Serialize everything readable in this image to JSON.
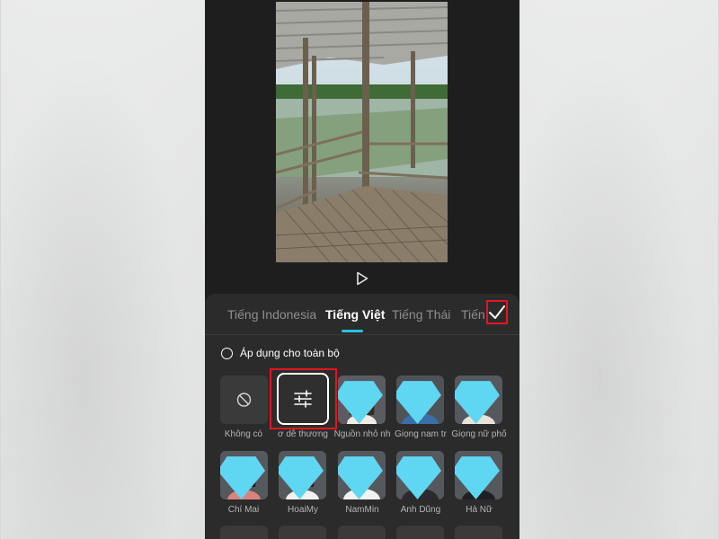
{
  "tabs": [
    {
      "label": "Tiếng Indonesia",
      "active": false
    },
    {
      "label": "Tiếng Việt",
      "active": true
    },
    {
      "label": "Tiếng Thái",
      "active": false
    },
    {
      "label": "Tiếng",
      "active": false
    }
  ],
  "apply_all_label": "Áp dụng cho toàn bộ",
  "voices_row1": [
    {
      "label": "Không có",
      "icon": "no-voice-icon"
    },
    {
      "label": "ơ dễ thương",
      "icon": "adjust-sliders-icon",
      "selected": true
    },
    {
      "label": "Nguồn nhỏ nh",
      "premium": true
    },
    {
      "label": "Giọng nam tr",
      "premium": true
    },
    {
      "label": "Giọng nữ phổ",
      "premium": true
    }
  ],
  "voices_row2": [
    {
      "label": "Chí Mai",
      "premium": true
    },
    {
      "label": "HoaiMy",
      "premium": true
    },
    {
      "label": "NamMin",
      "premium": true
    },
    {
      "label": "Anh Dũng",
      "premium": true
    },
    {
      "label": "Hà Nữ",
      "premium": true
    }
  ],
  "colors": {
    "accent": "#24c5db",
    "highlight": "#e1161e",
    "panel": "#2b2b2c",
    "background": "#1e1e1e",
    "premium": "#5fd7f2"
  }
}
